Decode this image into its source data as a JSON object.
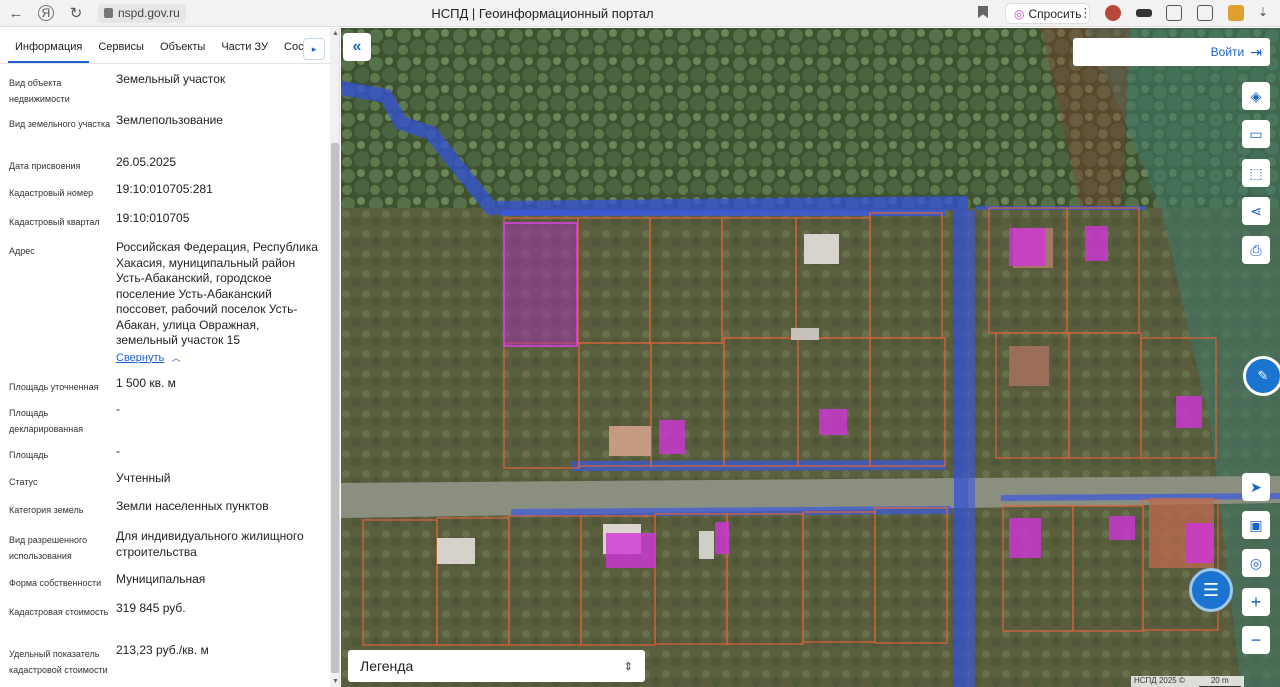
{
  "browser": {
    "url": "nspd.gov.ru",
    "title": "НСПД | Геоинформационный портал",
    "ask_label": "Спросить"
  },
  "sidebar": {
    "tabs": [
      "Информация",
      "Сервисы",
      "Объекты",
      "Части ЗУ",
      "Соста"
    ],
    "properties": [
      {
        "label": "Вид объекта недвижимости",
        "value": "Земельный участок"
      },
      {
        "label": "Вид земельного участка",
        "value": "Землепользование"
      },
      {
        "label": "Дата присвоения",
        "value": "26.05.2025"
      },
      {
        "label": "Кадастровый номер",
        "value": "19:10:010705:281"
      },
      {
        "label": "Кадастровый квартал",
        "value": "19:10:010705"
      },
      {
        "label": "Адрес",
        "value": "Российская Федерация, Республика Хакасия, муниципальный район Усть-Абаканский, городское поселение Усть-Абаканский поссовет, рабочий поселок Усть-Абакан, улица Овражная, земельный участок 15"
      },
      {
        "label": "Площадь уточненная",
        "value": "1 500 кв. м"
      },
      {
        "label": "Площадь декларированная",
        "value": "-"
      },
      {
        "label": "Площадь",
        "value": "-"
      },
      {
        "label": "Статус",
        "value": "Учтенный"
      },
      {
        "label": "Категория земель",
        "value": "Земли населенных пунктов"
      },
      {
        "label": "Вид разрешенного использования",
        "value": "Для индивидуального жилищного строительства"
      },
      {
        "label": "Форма собственности",
        "value": "Муниципальная"
      },
      {
        "label": "Кадастровая стоимость",
        "value": "319 845 руб."
      },
      {
        "label": "Удельный показатель кадастровой стоимости",
        "value": "213,23 руб./кв. м"
      }
    ],
    "collapse_link": "Свернуть"
  },
  "map": {
    "login_label": "Войти",
    "legend_label": "Легенда",
    "attribution": "НСПД 2025 ©",
    "scale": "20 m"
  }
}
